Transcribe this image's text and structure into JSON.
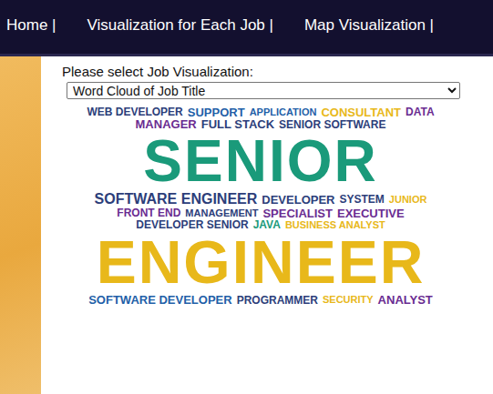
{
  "nav": {
    "items": [
      {
        "label": "Home |"
      },
      {
        "label": "Visualization for Each Job |"
      },
      {
        "label": "Map Visualization |"
      }
    ]
  },
  "form": {
    "label": "Please select Job Visualization:",
    "select": {
      "value": "Word Cloud of Job Title"
    }
  },
  "word_cloud": {
    "words": [
      {
        "text": "WEB DEVELOPER",
        "value": 6,
        "color": "#2c3e7a"
      },
      {
        "text": "SUPPORT",
        "value": 9,
        "color": "#1f5fa8"
      },
      {
        "text": "APPLICATION",
        "value": 5,
        "color": "#1f5fa8"
      },
      {
        "text": "CONSULTANT",
        "value": 9,
        "color": "#e8b81a"
      },
      {
        "text": "DATA",
        "value": 6,
        "color": "#6a2c91"
      },
      {
        "text": "MANAGER",
        "value": 9,
        "color": "#6a2c91"
      },
      {
        "text": "FULL STACK",
        "value": 9,
        "color": "#2c3e7a"
      },
      {
        "text": "SENIOR SOFTWARE",
        "value": 6,
        "color": "#2c3e7a"
      },
      {
        "text": "SENIOR",
        "value": 100,
        "color": "#1a9a7a"
      },
      {
        "text": "SOFTWARE ENGINEER",
        "value": 14,
        "color": "#2c3e7a"
      },
      {
        "text": "DEVELOPER",
        "value": 9,
        "color": "#2c3e7a"
      },
      {
        "text": "SYSTEM",
        "value": 7,
        "color": "#2c3e7a"
      },
      {
        "text": "JUNIOR",
        "value": 5,
        "color": "#e8b81a"
      },
      {
        "text": "FRONT END",
        "value": 6,
        "color": "#6a2c91"
      },
      {
        "text": "MANAGEMENT",
        "value": 4,
        "color": "#2c3e7a"
      },
      {
        "text": "SPECIALIST",
        "value": 9,
        "color": "#6a2c91"
      },
      {
        "text": "EXECUTIVE",
        "value": 8,
        "color": "#6a2c91"
      },
      {
        "text": "DEVELOPER SENIOR",
        "value": 6,
        "color": "#2c3e7a"
      },
      {
        "text": "JAVA",
        "value": 7,
        "color": "#1a9a7a"
      },
      {
        "text": "BUSINESS ANALYST",
        "value": 5,
        "color": "#e8b81a"
      },
      {
        "text": "ENGINEER",
        "value": 104,
        "color": "#e8b81a"
      },
      {
        "text": "SOFTWARE DEVELOPER",
        "value": 8,
        "color": "#1f5fa8"
      },
      {
        "text": "PROGRAMMER",
        "value": 6,
        "color": "#2c3e7a"
      },
      {
        "text": "SECURITY",
        "value": 5,
        "color": "#e8b81a"
      },
      {
        "text": "ANALYST",
        "value": 9,
        "color": "#6a2c91"
      }
    ]
  }
}
